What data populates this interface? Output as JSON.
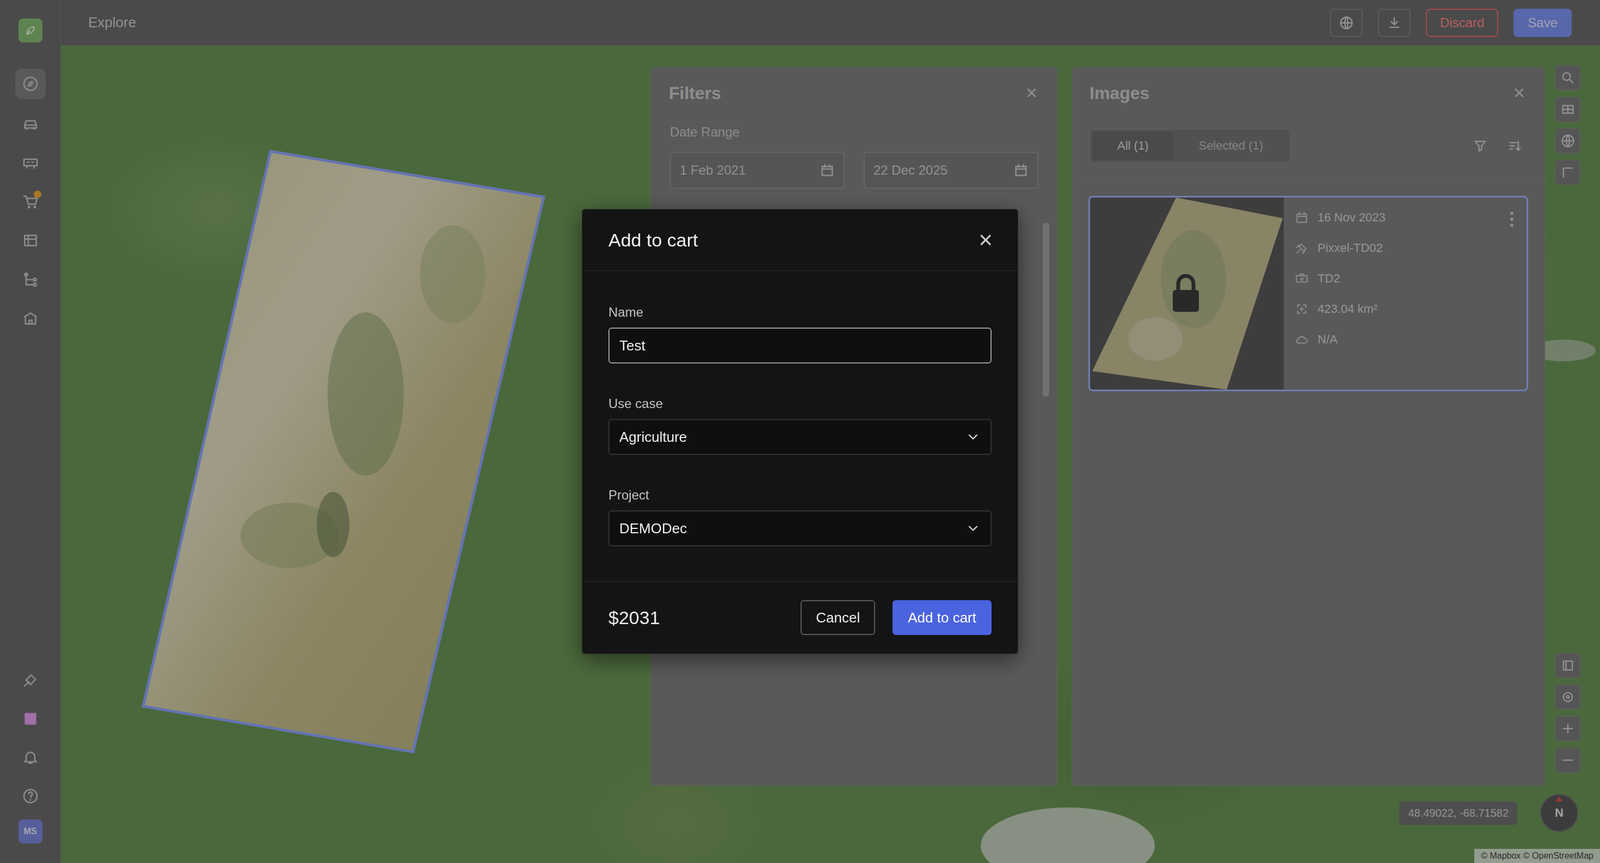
{
  "topbar": {
    "title": "Explore",
    "buttons": [
      {
        "label": "Discard",
        "kind": "danger"
      },
      {
        "label": "Save",
        "kind": "primary"
      }
    ]
  },
  "sidebar": {
    "items": [
      {
        "selected": true,
        "badge": false
      },
      {
        "selected": false,
        "badge": false
      },
      {
        "selected": false,
        "badge": false
      },
      {
        "selected": false,
        "badge": true
      },
      {
        "selected": false,
        "badge": false
      },
      {
        "selected": false,
        "badge": false
      },
      {
        "selected": false,
        "badge": false
      }
    ],
    "bottom_items": [
      {
        "selected": false
      },
      {
        "selected": false
      },
      {
        "selected": false
      },
      {
        "selected": false
      }
    ],
    "avatar": "MS"
  },
  "filters": {
    "title": "Filters",
    "close": "×",
    "date_range_label": "Date Range",
    "dates": [
      "1 Feb 2021",
      "22 Dec 2025"
    ]
  },
  "images": {
    "title": "Images",
    "close": "×",
    "tabs": [
      {
        "label": "All (1)",
        "selected": true
      },
      {
        "label": "Selected (1)",
        "selected": false
      }
    ],
    "cards": [
      {
        "selected": true,
        "locked": true,
        "meta": [
          "16 Nov 2023",
          "Pixxel-TD02",
          "TD2",
          "423.04 km²",
          "N/A"
        ]
      }
    ]
  },
  "map": {
    "coordinates": "48.49022, -68.71582",
    "compass": "N",
    "attribution": "© Mapbox © OpenStreetMap"
  },
  "modal": {
    "title": "Add to cart",
    "close": "×",
    "fields": [
      {
        "label": "Name",
        "value": "Test",
        "kind": "text",
        "focused": true
      },
      {
        "label": "Use case",
        "value": "Agriculture",
        "kind": "select",
        "focused": false
      },
      {
        "label": "Project",
        "value": "DEMODec",
        "kind": "select",
        "focused": false
      }
    ],
    "price": "$2031",
    "buttons": [
      {
        "label": "Cancel",
        "kind": "secondary"
      },
      {
        "label": "Add to cart",
        "kind": "primary"
      }
    ]
  }
}
